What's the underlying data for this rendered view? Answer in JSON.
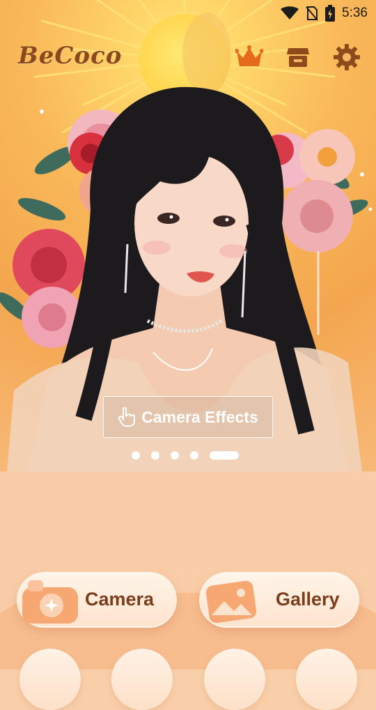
{
  "status_bar": {
    "time": "5:36",
    "icons": [
      "wifi-icon",
      "no-sim-icon",
      "battery-charging-icon"
    ]
  },
  "header": {
    "logo_text": "BeCoco",
    "icons": [
      "crown-icon",
      "store-icon",
      "settings-gear-icon"
    ]
  },
  "banner": {
    "cta_label": "Camera Effects",
    "cta_icon": "hand-pointer-icon",
    "carousel": {
      "total": 5,
      "active_index": 5
    }
  },
  "actions": {
    "camera_label": "Camera",
    "gallery_label": "Gallery"
  },
  "colors": {
    "accent_text": "#7a3e1c",
    "logo": "#8a4a1e",
    "panel_bg": "#f9cda8",
    "icon_orange": "#e56a1c",
    "icon_brown": "#8e4a1b"
  }
}
